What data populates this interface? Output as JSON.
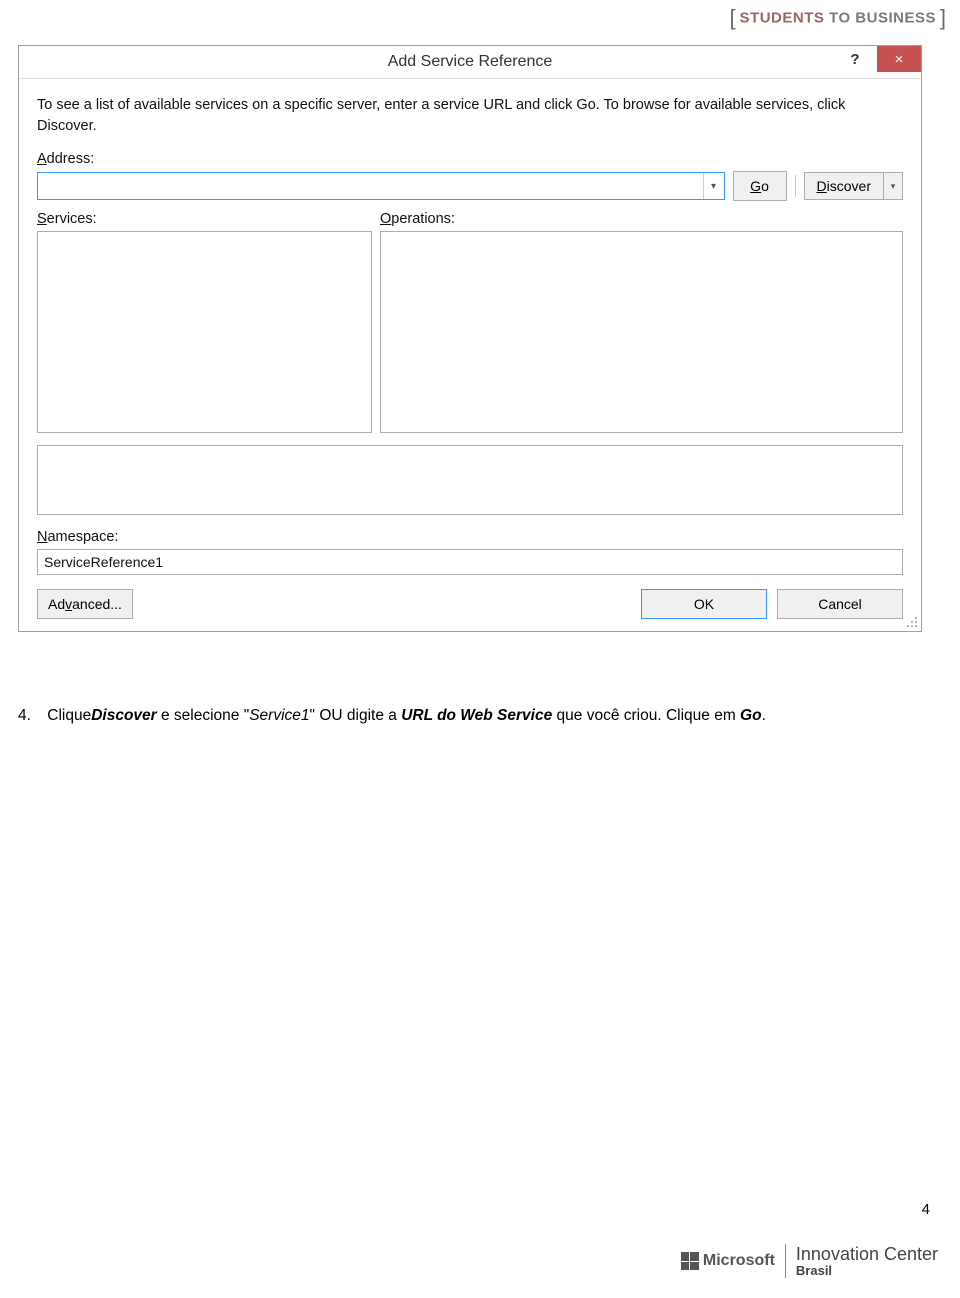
{
  "header_logo": {
    "left_bracket": "[",
    "word1": "STUDENTS",
    "connector": " TO ",
    "word2": "BUSINESS",
    "right_bracket": "]"
  },
  "dialog": {
    "title": "Add Service Reference",
    "help_glyph": "?",
    "close_glyph": "×",
    "instruction": "To see a list of available services on a specific server, enter a service URL and click Go. To browse for available services, click Discover.",
    "address_label_pre": "A",
    "address_label_post": "ddress:",
    "address_value": "",
    "combo_arrow": "▾",
    "go_pre": "G",
    "go_post": "o",
    "discover_pre": "D",
    "discover_post": "iscover",
    "discover_arrow": "▾",
    "services_label_pre": "S",
    "services_label_post": "ervices:",
    "operations_label_pre": "O",
    "operations_label_post": "perations:",
    "namespace_label_pre": "N",
    "namespace_label_post": "amespace:",
    "namespace_value": "ServiceReference1",
    "advanced_pre": "Ad",
    "advanced_ul": "v",
    "advanced_post": "anced...",
    "ok": "OK",
    "cancel": "Cancel"
  },
  "doc": {
    "number": "4.",
    "t1": "Clique",
    "t2": "Discover",
    "t3": " e selecione \"",
    "t4": "Service1",
    "t5": "\" OU digite a ",
    "t6": "URL do Web Service",
    "t7": " que você criou. Clique em ",
    "t8": "Go",
    "t9": "."
  },
  "page_number": "4",
  "footer": {
    "microsoft": "Microsoft",
    "line1": "Innovation Center",
    "line2": "Brasil"
  }
}
